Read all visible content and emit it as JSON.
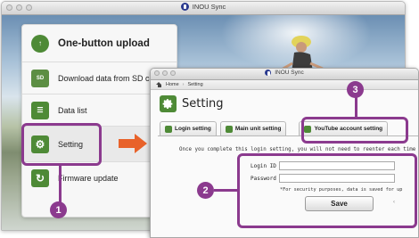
{
  "back_window": {
    "title": "INOU Sync",
    "menu": [
      {
        "label": "One-button upload",
        "icon": "upload-icon",
        "icon_glyph": "↑"
      },
      {
        "label": "Download data from SD card",
        "icon": "sd-card-icon",
        "icon_glyph": "SD"
      },
      {
        "label": "Data list",
        "icon": "list-icon",
        "icon_glyph": "☰"
      },
      {
        "label": "Setting",
        "icon": "gear-icon",
        "icon_glyph": "⚙"
      },
      {
        "label": "Firmware update",
        "icon": "refresh-icon",
        "icon_glyph": "↻"
      }
    ]
  },
  "front_window": {
    "title": "INOU Sync",
    "breadcrumb": {
      "home": "Home",
      "current": "Setting"
    },
    "heading": "Setting",
    "tabs": [
      "Login setting",
      "Main unit setting",
      "YouTube account setting"
    ],
    "info_text": "Once you complete this login setting, you will not need to reenter each time",
    "login_id_label": "Login ID",
    "login_id_value": "",
    "password_label": "Password",
    "password_value": "",
    "note": "*For security purposes, data is saved for up",
    "save_label": "Save"
  },
  "callouts": [
    "1",
    "2",
    "3"
  ],
  "colors": {
    "accent": "#8b3a8e",
    "icon_green": "#4e8a36",
    "arrow": "#e8622a"
  }
}
